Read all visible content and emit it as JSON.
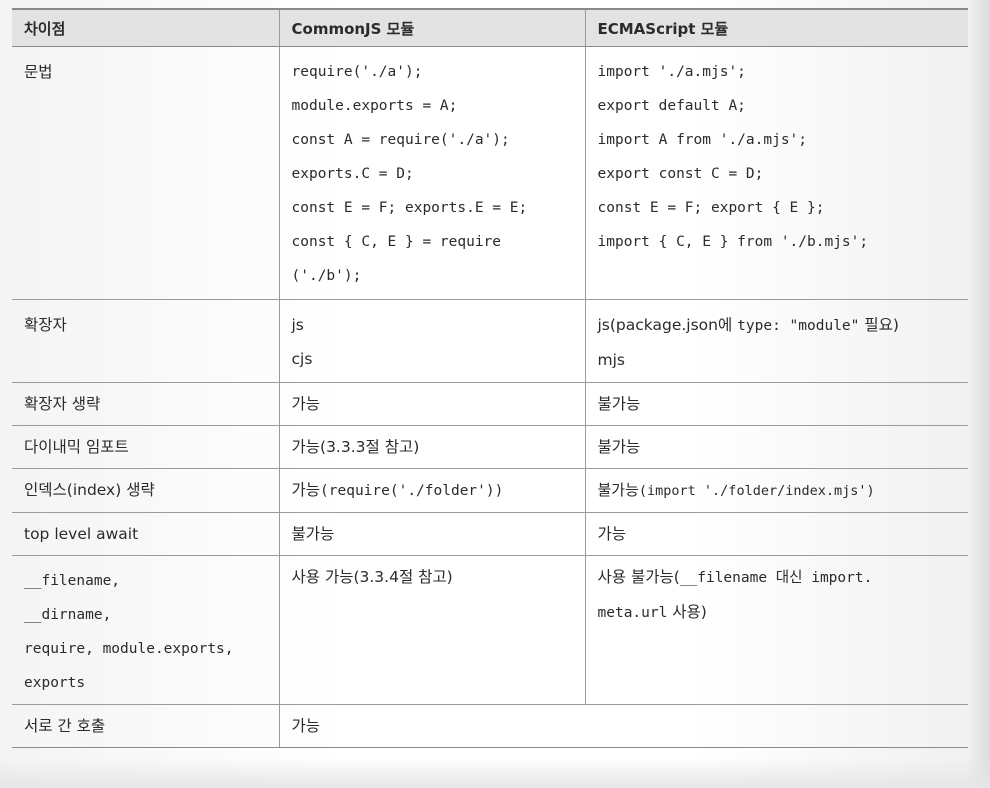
{
  "header": {
    "col1": "차이점",
    "col2": "CommonJS 모듈",
    "col3": "ECMAScript 모듈"
  },
  "rows": {
    "syntax": {
      "label": "문법",
      "cjs": [
        "require('./a');",
        "module.exports = A;",
        "const A = require('./a');",
        "exports.C = D;",
        "const E = F; exports.E = E;",
        "const { C, E } = require",
        "('./b');"
      ],
      "esm": [
        "import './a.mjs';",
        "export default A;",
        "import A from './a.mjs';",
        "export const C = D;",
        "const E = F; export { E };",
        "import { C, E } from './b.mjs';"
      ]
    },
    "extension": {
      "label": "확장자",
      "cjs": [
        "js",
        "cjs"
      ],
      "esm_line1_prefix": "js(package.json에 ",
      "esm_line1_code": "type: \"module\"",
      "esm_line1_suffix": " 필요)",
      "esm_line2": "mjs"
    },
    "ext_omit": {
      "label": "확장자 생략",
      "cjs": "가능",
      "esm": "불가능"
    },
    "dynamic_import": {
      "label": "다이내믹 임포트",
      "cjs": "가능(3.3.3절 참고)",
      "esm": "불가능"
    },
    "index_omit": {
      "label": "인덱스(index) 생략",
      "cjs_prefix": "가능",
      "cjs_code": "(require('./folder'))",
      "esm_prefix": "불가능",
      "esm_code": "(import './folder/index.mjs')"
    },
    "top_level_await": {
      "label": "top level await",
      "cjs": "불가능",
      "esm": "가능"
    },
    "globals": {
      "label_lines": [
        "__filename,",
        "__dirname,",
        "require, module.exports,",
        "exports"
      ],
      "cjs": "사용 가능(3.3.4절 참고)",
      "esm_line1_prefix": "사용 불가능(",
      "esm_line1_code": "__filename 대신 import.",
      "esm_line2_code": "meta.url",
      "esm_line2_suffix": " 사용)"
    },
    "interop": {
      "label": "서로 간 호출",
      "value": "가능"
    }
  }
}
